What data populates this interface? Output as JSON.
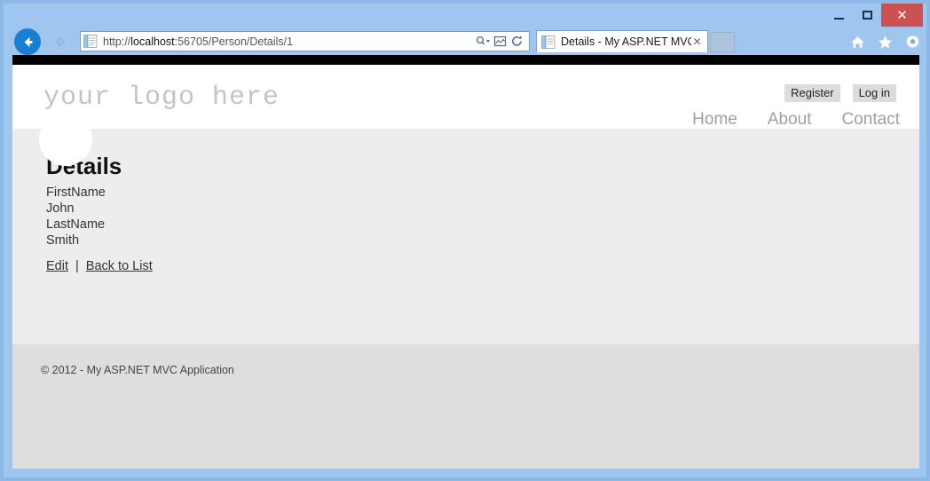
{
  "browser": {
    "window_controls": {
      "minimize_label": "–",
      "maximize_label": "□",
      "close_label": "✕"
    },
    "navigation": {
      "back_label": "←",
      "forward_label": "→"
    },
    "address": {
      "url_scheme": "http://",
      "url_host": "localhost",
      "url_rest": ":56705/Person/Details/1",
      "url_full": "http://localhost:56705/Person/Details/1"
    },
    "address_icons": [
      {
        "name": "search-dropdown-icon",
        "glyph": "⌕"
      },
      {
        "name": "compatibility-view-icon",
        "glyph": "☒"
      },
      {
        "name": "refresh-icon",
        "glyph": "⟳"
      }
    ],
    "tab": {
      "title": "Details - My ASP.NET MVC ...",
      "close_label": "✕"
    },
    "toolbar_icons": [
      {
        "name": "home-icon",
        "glyph": "⌂"
      },
      {
        "name": "favorites-icon",
        "glyph": "★"
      },
      {
        "name": "tools-icon",
        "glyph": "⚙"
      }
    ]
  },
  "site": {
    "logo_text": "your logo here",
    "auth_links": [
      {
        "label": "Register"
      },
      {
        "label": "Log in"
      }
    ],
    "nav_links": [
      {
        "label": "Home"
      },
      {
        "label": "About"
      },
      {
        "label": "Contact"
      }
    ]
  },
  "page": {
    "title": "Details",
    "fields": [
      {
        "label": "FirstName",
        "value": "John"
      },
      {
        "label": "LastName",
        "value": "Smith"
      }
    ],
    "detail_lines": [
      "FirstName",
      "John",
      "LastName",
      "Smith"
    ],
    "actions": {
      "edit_label": "Edit",
      "separator": "|",
      "back_label": "Back to List"
    }
  },
  "footer": {
    "copyright": "© 2012 - My ASP.NET MVC Application"
  },
  "colors": {
    "window_frame": "#8cb8e8",
    "close_button": "#cc5252",
    "black_bar": "#000000",
    "body_bg": "#ededed",
    "footer_bg": "#dedede",
    "logo_gray": "#c4c4c4",
    "nav_gray": "#a0a0a0",
    "auth_bg": "#dcdcdc",
    "back_button_blue": "#1a7fd4"
  }
}
